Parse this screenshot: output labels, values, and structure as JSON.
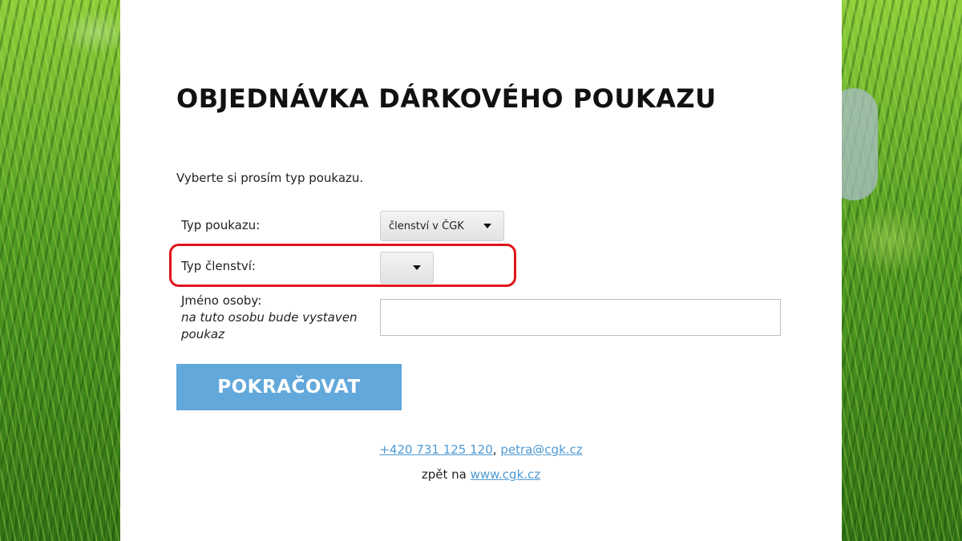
{
  "page": {
    "title": "OBJEDNÁVKA DÁRKOVÉHO POUKAZU",
    "intro": "Vyberte si prosím typ poukazu."
  },
  "form": {
    "voucher_type": {
      "label": "Typ poukazu:",
      "selected": "členství v ČGK"
    },
    "membership_type": {
      "label": "Typ členství:",
      "selected": ""
    },
    "person_name": {
      "label": "Jméno osoby:",
      "hint": "na tuto osobu bude vystaven poukaz",
      "value": ""
    },
    "submit_label": "POKRAČOVAT"
  },
  "footer": {
    "phone": "+420 731 125 120",
    "separator": ",",
    "email": "petra@cgk.cz",
    "back_prefix": "zpět na",
    "website": "www.cgk.cz"
  },
  "colors": {
    "accent_button": "#62a8db",
    "link": "#4f9ad3",
    "highlight_outline": "#e0141b"
  },
  "icons": {
    "dropdown": "caret-down-icon"
  }
}
